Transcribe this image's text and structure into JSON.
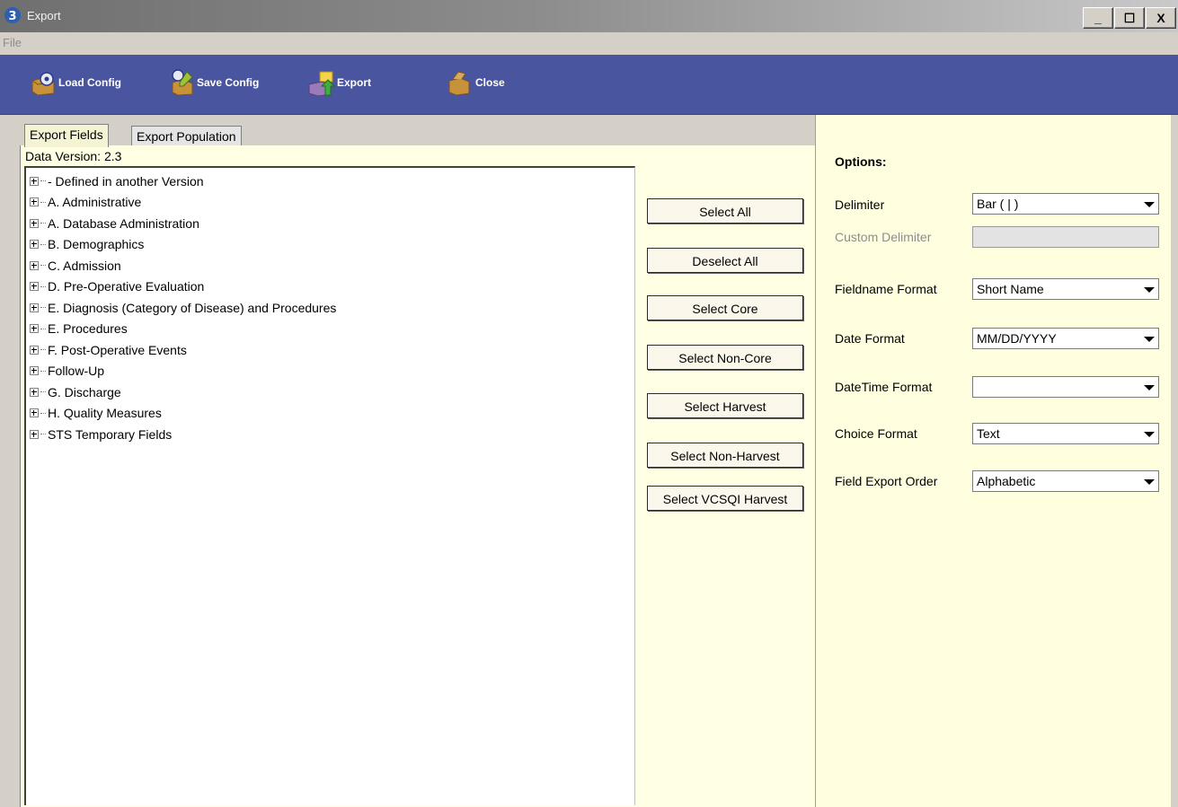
{
  "window": {
    "title": "Export",
    "minimize_label": "_",
    "maximize_label": "☐",
    "close_label": "X"
  },
  "menu": {
    "file_label": "File"
  },
  "toolbar": {
    "load_config": "Load Config",
    "save_config": "Save Config",
    "export": "Export",
    "close": "Close"
  },
  "tabs": {
    "export_fields": "Export Fields",
    "export_population": "Export Population"
  },
  "data_version": "Data Version: 2.3",
  "tree_items": [
    "- Defined in another Version",
    "A. Administrative",
    "A. Database Administration",
    "B. Demographics",
    "C. Admission",
    "D. Pre-Operative Evaluation",
    "E. Diagnosis (Category of Disease) and Procedures",
    "E. Procedures",
    "F. Post-Operative Events",
    "Follow-Up",
    "G. Discharge",
    "H. Quality Measures",
    "STS Temporary Fields"
  ],
  "buttons": {
    "select_all": "Select All",
    "deselect_all": "Deselect All",
    "select_core": "Select Core",
    "select_non_core": "Select Non-Core",
    "select_harvest": "Select Harvest",
    "select_non_harvest": "Select Non-Harvest",
    "select_vcsqi_harvest": "Select VCSQI Harvest"
  },
  "options": {
    "heading": "Options:",
    "delimiter_label": "Delimiter",
    "delimiter_value": "Bar ( | )",
    "custom_delimiter_label": "Custom Delimiter",
    "custom_delimiter_value": "",
    "fieldname_format_label": "Fieldname Format",
    "fieldname_format_value": "Short Name",
    "date_format_label": "Date Format",
    "date_format_value": "MM/DD/YYYY",
    "datetime_format_label": "DateTime Format",
    "datetime_format_value": "",
    "choice_format_label": "Choice Format",
    "choice_format_value": "Text",
    "field_export_order_label": "Field Export Order",
    "field_export_order_value": "Alphabetic"
  },
  "colors": {
    "toolbar_bg": "#4a55a0",
    "panel_bg": "#ffffe0"
  }
}
